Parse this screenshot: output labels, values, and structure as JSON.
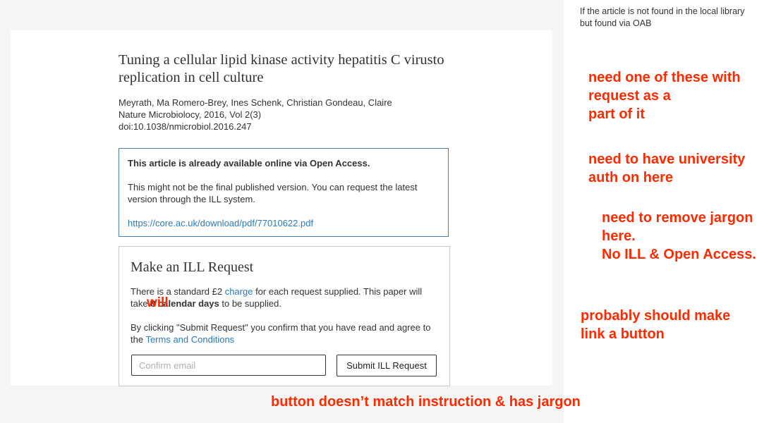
{
  "side_note": "If the article is not found in the local library but found via OAB",
  "article": {
    "title": "Tuning a cellular lipid kinase activity hepatitis C virusto replication in cell culture",
    "authors": "Meyrath, Ma Romero-Brey, Ines Schenk, Christian Gondeau, Claire",
    "journal": "Nature Microbiolocy, 2016, Vol 2(3)",
    "doi": "doi:10.1038/nmicrobiol.2016.247"
  },
  "open_access": {
    "headline": "This article is already available online via Open Access.",
    "body": "This might not be the final published version. You can request the latest version through the ILL system.",
    "link": "https://core.ac.uk/download/pdf/77010622.pdf"
  },
  "ill_request": {
    "heading": "Make an ILL Request",
    "fee_pre": "There is a standard £2 ",
    "fee_link": "charge",
    "fee_mid": " for each request supplied. This paper will take ",
    "fee_days": "8 calendar days",
    "fee_post": " to be supplied.",
    "confirm_pre": "By clicking \"Submit Request\" you confirm that you have read and agree to the ",
    "terms_link": "Terms and Conditions",
    "email_placeholder": "Confirm email",
    "submit_label": "Submit ILL Request"
  },
  "annotations": {
    "inline_will": "will",
    "request_part": "need one of these with\nrequest as a\npart of it",
    "university_auth": "need to have university\nauth on here",
    "remove_jargon": "need to remove jargon\nhere.\nNo ILL & Open Access.",
    "link_button": "probably should make\nlink a button",
    "button_mismatch": "button doesn’t match instruction & has jargon"
  },
  "colors": {
    "annotation": "#ff2a00",
    "link": "#2a7ab8",
    "oa_border": "#4a7fb0"
  }
}
